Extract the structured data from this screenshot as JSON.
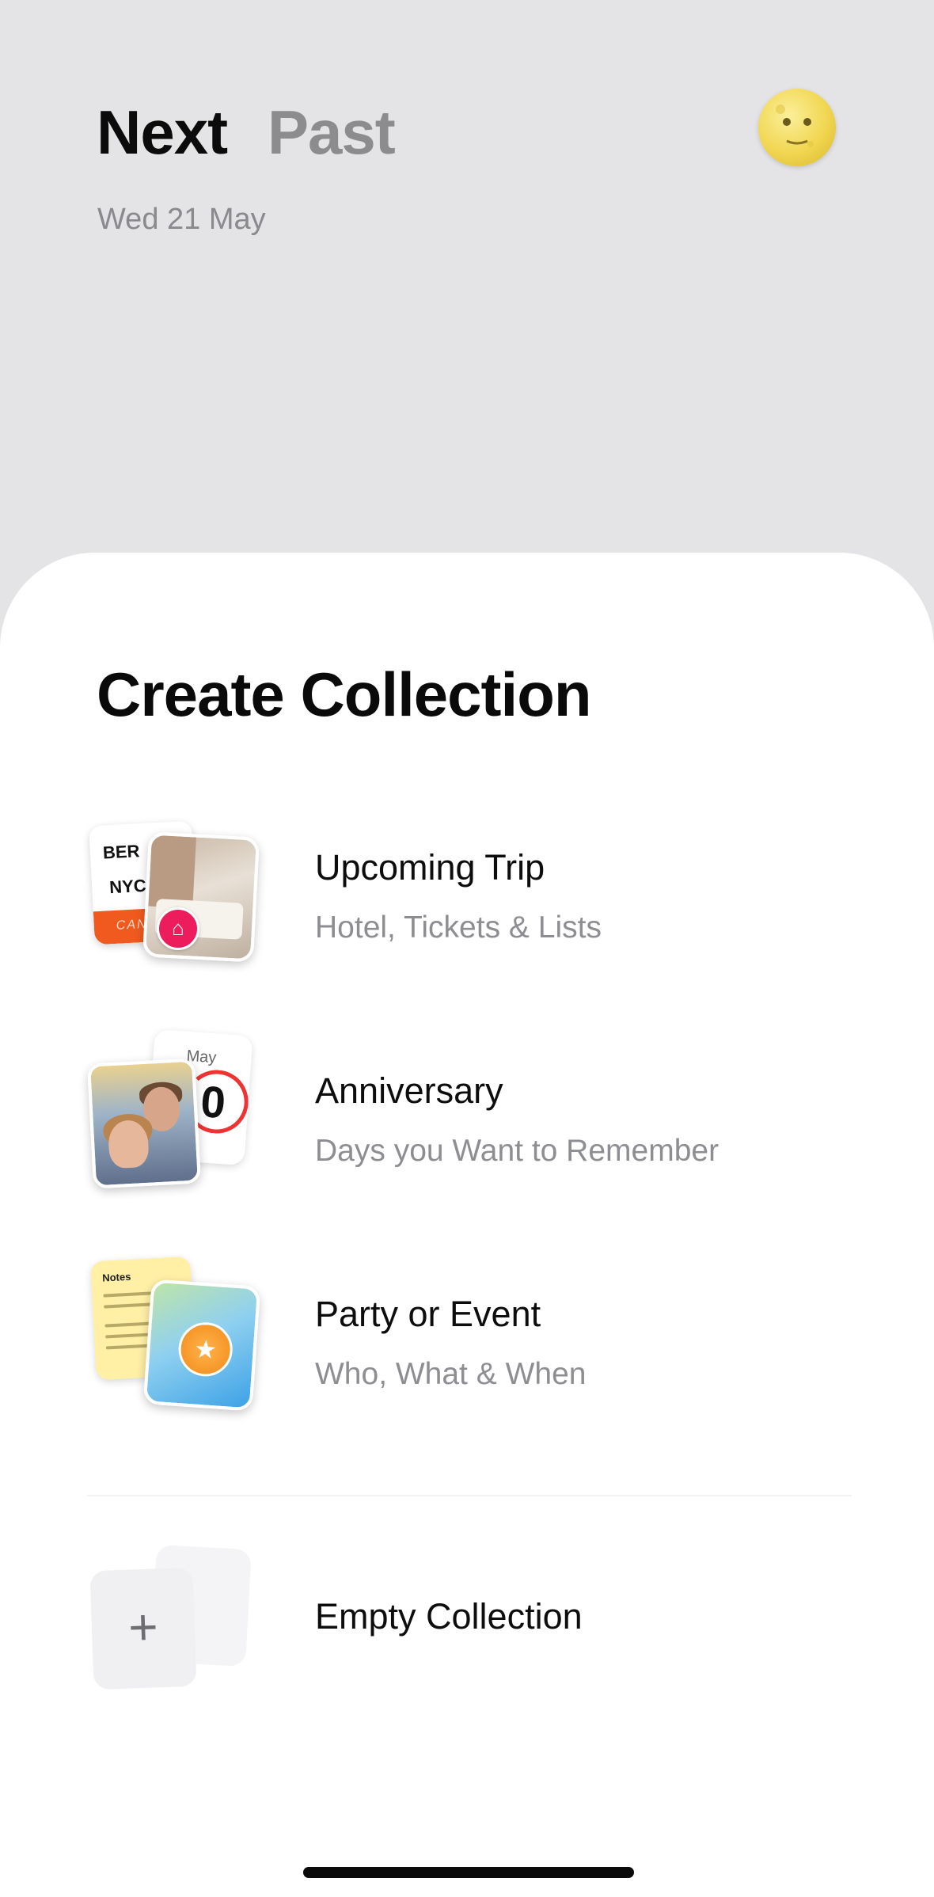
{
  "header": {
    "tabs": [
      {
        "label": "Next",
        "active": true
      },
      {
        "label": "Past",
        "active": false
      }
    ],
    "date": "Wed 21 May",
    "avatar_icon": "full-moon-face-icon"
  },
  "sheet": {
    "title": "Create Collection",
    "options": [
      {
        "title": "Upcoming Trip",
        "subtitle": "Hotel, Tickets & Lists",
        "thumb": {
          "ticket_from": "BER",
          "ticket_to": "NYC",
          "ticket_band": "CANO",
          "badge_icon": "airbnb-icon"
        }
      },
      {
        "title": "Anniversary",
        "subtitle": "Days you Want to Remember",
        "thumb": {
          "calendar_month": "May",
          "calendar_day": "0"
        }
      },
      {
        "title": "Party or Event",
        "subtitle": "Who, What & When",
        "thumb": {
          "note_title": "Notes",
          "pin_icon": "star-pin-icon"
        }
      },
      {
        "title": "Empty Collection",
        "subtitle": "",
        "thumb": {
          "icon": "plus-icon",
          "glyph": "+"
        }
      }
    ]
  },
  "colors": {
    "background": "#e4e3e6",
    "sheet": "#ffffff",
    "primary_text": "#0b0b0b",
    "secondary_text": "#8d8d92",
    "ticket_orange": "#f15a1f",
    "airbnb_pink": "#ec1c5d"
  }
}
